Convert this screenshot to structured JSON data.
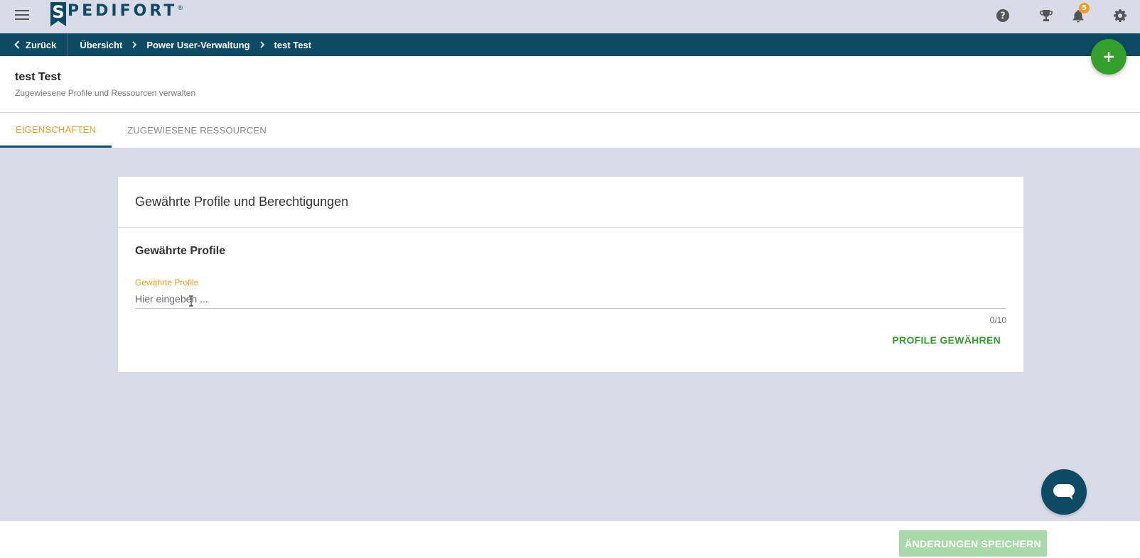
{
  "app": {
    "logo_letter": "S",
    "logo_text": "PEDIFORT",
    "logo_reg": "®"
  },
  "topbar": {
    "icons": [
      "menu-icon",
      "help-icon",
      "trophy-icon",
      "bell-icon",
      "gear-icon"
    ],
    "notifications_count": "5"
  },
  "breadcrumb": {
    "back_label": "Zurück",
    "items": [
      "Übersicht",
      "Power User-Verwaltung",
      "test Test"
    ]
  },
  "header": {
    "title": "test Test",
    "subtitle": "Zugewiesene Profile und Ressourcen verwalten"
  },
  "tabs": [
    {
      "label": "EIGENSCHAFTEN",
      "active": true
    },
    {
      "label": "ZUGEWIESENE RESSOURCEN",
      "active": false
    }
  ],
  "card": {
    "title": "Gewährte Profile und Berechtigungen",
    "section_title": "Gewährte Profile",
    "field_label": "Gewährte Profile",
    "field_placeholder": "Hier eingeben ...",
    "counter": "0/10",
    "grant_button": "PROFILE GEWÄHREN"
  },
  "footer": {
    "save_button": "ÄNDERUNGEN SPEICHERN"
  },
  "colors": {
    "primary": "#0d4a64",
    "accent": "#f0a020",
    "green": "#33a02c",
    "background": "#d9dce6"
  }
}
